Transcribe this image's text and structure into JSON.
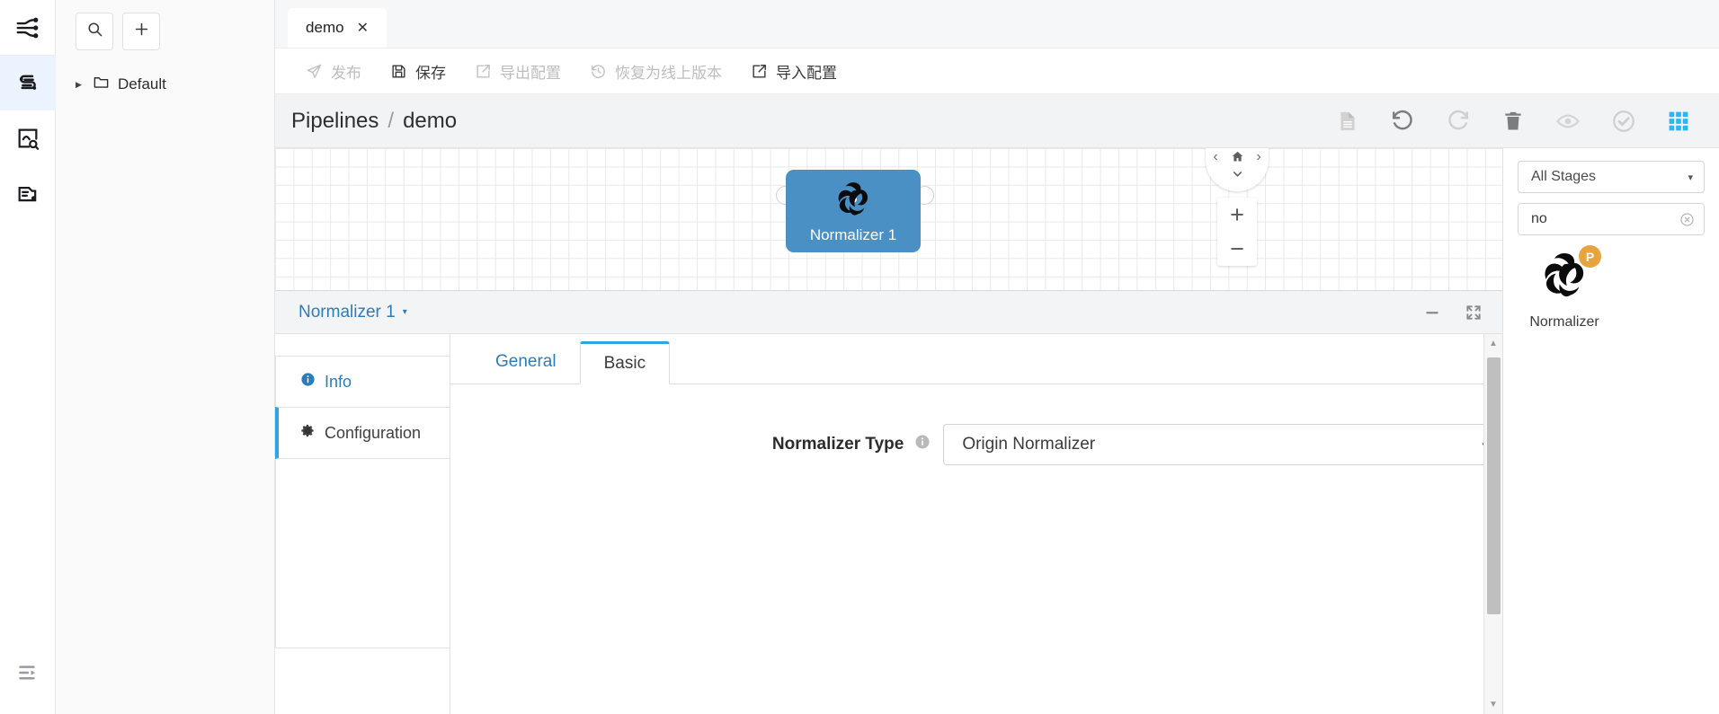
{
  "rail": {
    "items": [
      {
        "icon": "flow-branch-icon",
        "active": false
      },
      {
        "icon": "pipeline-icon",
        "active": true
      },
      {
        "icon": "chart-search-icon",
        "active": false
      },
      {
        "icon": "toolbox-icon",
        "active": false
      }
    ],
    "collapse": {
      "icon": "collapse-sidebar-icon"
    }
  },
  "sidebar": {
    "search_icon": "search-icon",
    "add_icon": "plus-icon",
    "tree": [
      {
        "label": "Default",
        "icon": "folder-icon",
        "expanded": false
      }
    ]
  },
  "tabs": {
    "open": [
      {
        "label": "demo",
        "close": "✕",
        "active": true
      }
    ]
  },
  "toolbar": {
    "actions": [
      {
        "label": "发布",
        "icon": "publish-icon",
        "disabled": true
      },
      {
        "label": "保存",
        "icon": "save-icon",
        "disabled": false
      },
      {
        "label": "导出配置",
        "icon": "export-icon",
        "disabled": true
      },
      {
        "label": "恢复为线上版本",
        "icon": "restore-icon",
        "disabled": true
      },
      {
        "label": "导入配置",
        "icon": "import-icon",
        "disabled": false
      }
    ]
  },
  "breadcrumb": {
    "root": "Pipelines",
    "separator": "/",
    "current": "demo",
    "icons": [
      {
        "name": "document-icon",
        "disabled": true
      },
      {
        "name": "undo-icon",
        "disabled": false
      },
      {
        "name": "redo-icon",
        "disabled": true
      },
      {
        "name": "trash-icon",
        "disabled": false
      },
      {
        "name": "eye-icon",
        "disabled": true
      },
      {
        "name": "check-circle-icon",
        "disabled": true
      },
      {
        "name": "grid-apps-icon",
        "disabled": false,
        "color": "#29b6f2"
      }
    ]
  },
  "canvas": {
    "node": {
      "label": "Normalizer 1",
      "icon": "normalizer-swirl-icon",
      "color": "#4a90c4",
      "ports": {
        "in": "input-port",
        "out": "output-port"
      }
    },
    "navpad": {
      "left": "‹",
      "home": "home-icon",
      "right": "›",
      "down": "⌄"
    },
    "zoom": {
      "in": "+",
      "out": "−"
    }
  },
  "panel": {
    "title": "Normalizer 1",
    "caret": "▾",
    "minimize_icon": "minimize-icon",
    "expand_icon": "expand-icon",
    "vtabs": [
      {
        "label": "Info",
        "icon": "info-icon",
        "active": false
      },
      {
        "label": "Configuration",
        "icon": "gear-icon",
        "active": true
      }
    ],
    "htabs": [
      {
        "label": "General",
        "active": false
      },
      {
        "label": "Basic",
        "active": true
      }
    ],
    "form": {
      "fields": [
        {
          "label": "Normalizer Type",
          "help_icon": "info-circle-icon",
          "value": "Origin Normalizer",
          "caret": "▾"
        }
      ]
    }
  },
  "palette": {
    "stage_filter": {
      "value": "All Stages",
      "caret": "▾"
    },
    "search": {
      "value": "no",
      "placeholder": "",
      "clear_icon": "clear-circle-icon"
    },
    "items": [
      {
        "name": "Normalizer",
        "icon": "normalizer-swirl-icon",
        "badge": "P",
        "badge_color": "#e8a33d"
      }
    ]
  }
}
